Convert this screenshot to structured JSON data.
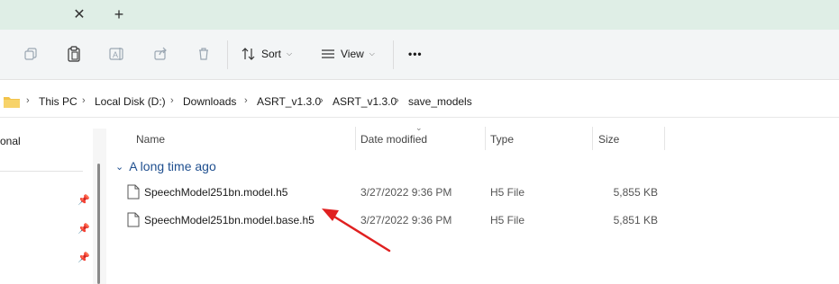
{
  "tabbar": {
    "close_glyph": "✕",
    "new_tab_glyph": "+"
  },
  "toolbar": {
    "icons": [
      "copy-icon",
      "paste-icon",
      "rename-icon",
      "share-icon",
      "delete-icon"
    ],
    "sort_label": "Sort",
    "view_label": "View",
    "more_label": "•••"
  },
  "breadcrumb": [
    "This PC",
    "Local Disk (D:)",
    "Downloads",
    "ASRT_v1.3.0",
    "ASRT_v1.3.0",
    "save_models"
  ],
  "nav": {
    "partial_label": "onal"
  },
  "columns": {
    "name": "Name",
    "date": "Date modified",
    "type": "Type",
    "size": "Size"
  },
  "group": {
    "label": "A long time ago"
  },
  "files": [
    {
      "name": "SpeechModel251bn.model.h5",
      "date": "3/27/2022 9:36 PM",
      "type": "H5 File",
      "size": "5,855 KB"
    },
    {
      "name": "SpeechModel251bn.model.base.h5",
      "date": "3/27/2022 9:36 PM",
      "type": "H5 File",
      "size": "5,851 KB"
    }
  ],
  "colors": {
    "accent": "#1f4f8f",
    "annotation": "#e02020",
    "folder": "#f2c34a"
  }
}
